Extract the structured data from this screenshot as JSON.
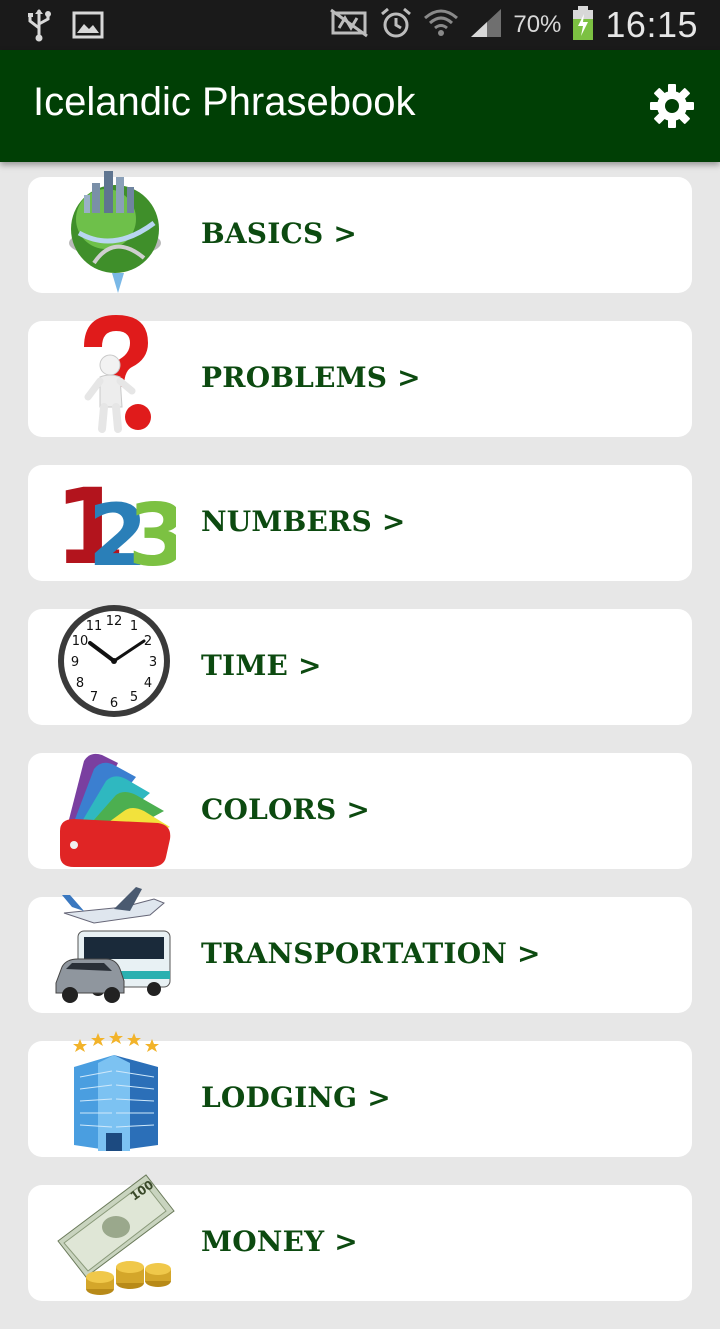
{
  "status_bar": {
    "battery_percent": "70%",
    "time": "16:15",
    "icons": [
      "usb-icon",
      "image-icon",
      "no-nfc-icon",
      "alarm-icon",
      "wifi-icon",
      "signal-icon",
      "battery-charging-icon"
    ]
  },
  "app_bar": {
    "title": "Icelandic Phrasebook",
    "settings_icon": "gear-icon"
  },
  "categories": [
    {
      "label": "BASICS >",
      "icon": "globe-city-icon"
    },
    {
      "label": "PROBLEMS >",
      "icon": "question-mark-person-icon"
    },
    {
      "label": "NUMBERS >",
      "icon": "numbers-123-icon"
    },
    {
      "label": "TIME >",
      "icon": "clock-icon"
    },
    {
      "label": "COLORS >",
      "icon": "color-swatch-icon"
    },
    {
      "label": "TRANSPORTATION >",
      "icon": "vehicles-icon"
    },
    {
      "label": "LODGING >",
      "icon": "hotel-icon"
    },
    {
      "label": "MONEY >",
      "icon": "money-icon"
    }
  ],
  "colors": {
    "app_bar": "#003f05",
    "label": "#0c4a10",
    "background": "#e7e7e7"
  }
}
